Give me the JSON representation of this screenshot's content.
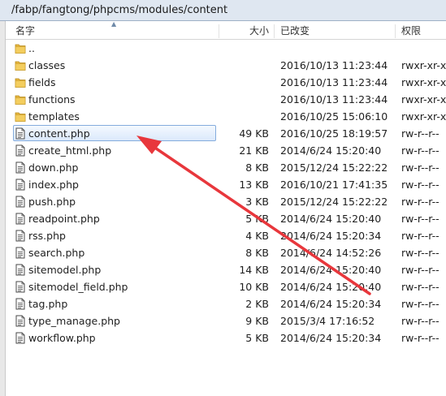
{
  "path_bar": {
    "path": "/fabp/fangtong/phpcms/modules/content"
  },
  "columns": {
    "name": "名字",
    "size": "大小",
    "modified": "已改变",
    "permissions": "权限"
  },
  "files": [
    {
      "name": "..",
      "type": "folder",
      "size": "",
      "modified": "",
      "permissions": ""
    },
    {
      "name": "classes",
      "type": "folder",
      "size": "",
      "modified": "2016/10/13 11:23:44",
      "permissions": "rwxr-xr-x"
    },
    {
      "name": "fields",
      "type": "folder",
      "size": "",
      "modified": "2016/10/13 11:23:44",
      "permissions": "rwxr-xr-x"
    },
    {
      "name": "functions",
      "type": "folder",
      "size": "",
      "modified": "2016/10/13 11:23:44",
      "permissions": "rwxr-xr-x"
    },
    {
      "name": "templates",
      "type": "folder",
      "size": "",
      "modified": "2016/10/25 15:06:10",
      "permissions": "rwxr-xr-x"
    },
    {
      "name": "content.php",
      "type": "file",
      "size": "49 KB",
      "modified": "2016/10/25 18:19:57",
      "permissions": "rw-r--r--",
      "selected": true
    },
    {
      "name": "create_html.php",
      "type": "file",
      "size": "21 KB",
      "modified": "2014/6/24 15:20:40",
      "permissions": "rw-r--r--"
    },
    {
      "name": "down.php",
      "type": "file",
      "size": "8 KB",
      "modified": "2015/12/24 15:22:22",
      "permissions": "rw-r--r--"
    },
    {
      "name": "index.php",
      "type": "file",
      "size": "13 KB",
      "modified": "2016/10/21 17:41:35",
      "permissions": "rw-r--r--"
    },
    {
      "name": "push.php",
      "type": "file",
      "size": "3 KB",
      "modified": "2015/12/24 15:22:22",
      "permissions": "rw-r--r--"
    },
    {
      "name": "readpoint.php",
      "type": "file",
      "size": "5 KB",
      "modified": "2014/6/24 15:20:40",
      "permissions": "rw-r--r--"
    },
    {
      "name": "rss.php",
      "type": "file",
      "size": "4 KB",
      "modified": "2014/6/24 15:20:34",
      "permissions": "rw-r--r--"
    },
    {
      "name": "search.php",
      "type": "file",
      "size": "8 KB",
      "modified": "2014/6/24 14:52:26",
      "permissions": "rw-r--r--"
    },
    {
      "name": "sitemodel.php",
      "type": "file",
      "size": "14 KB",
      "modified": "2014/6/24 15:20:40",
      "permissions": "rw-r--r--"
    },
    {
      "name": "sitemodel_field.php",
      "type": "file",
      "size": "10 KB",
      "modified": "2014/6/24 15:20:40",
      "permissions": "rw-r--r--"
    },
    {
      "name": "tag.php",
      "type": "file",
      "size": "2 KB",
      "modified": "2014/6/24 15:20:34",
      "permissions": "rw-r--r--"
    },
    {
      "name": "type_manage.php",
      "type": "file",
      "size": "9 KB",
      "modified": "2015/3/4 17:16:52",
      "permissions": "rw-r--r--"
    },
    {
      "name": "workflow.php",
      "type": "file",
      "size": "5 KB",
      "modified": "2014/6/24 15:20:34",
      "permissions": "rw-r--r--"
    }
  ],
  "colors": {
    "selection_border": "#84acdd",
    "annotation_arrow": "#e8373c",
    "folder": "#e7b73f"
  }
}
